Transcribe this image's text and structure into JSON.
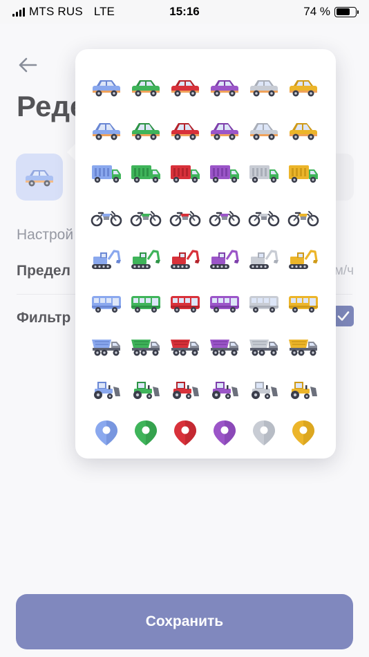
{
  "status_bar": {
    "carrier": "MTS RUS",
    "network": "LTE",
    "time": "15:16",
    "battery_percent": "74 %",
    "battery_level": 0.74
  },
  "page": {
    "title": "Реде",
    "section_label": "Настрой",
    "limit_label": "Предел",
    "limit_unit": "м/ч",
    "filter_label": "Фильтр",
    "filter_checked": true,
    "save_button": "Сохранить"
  },
  "icon_picker": {
    "colors": [
      {
        "name": "blue",
        "main": "#8aa8ee",
        "dark": "#6a87d4"
      },
      {
        "name": "green",
        "main": "#3fb45a",
        "dark": "#2d9346"
      },
      {
        "name": "red",
        "main": "#d8313a",
        "dark": "#b4232b"
      },
      {
        "name": "purple",
        "main": "#9b55c8",
        "dark": "#7e3fab"
      },
      {
        "name": "silver",
        "main": "#c8ccd4",
        "dark": "#a9aeb8"
      },
      {
        "name": "yellow",
        "main": "#ecb52a",
        "dark": "#cf9a18"
      }
    ],
    "rows": [
      {
        "type": "car-icon"
      },
      {
        "type": "hatchback-icon"
      },
      {
        "type": "cargo-truck-icon"
      },
      {
        "type": "motorcycle-icon"
      },
      {
        "type": "excavator-icon"
      },
      {
        "type": "bus-icon"
      },
      {
        "type": "dump-truck-icon"
      },
      {
        "type": "tractor-icon"
      },
      {
        "type": "map-pin-icon"
      }
    ]
  }
}
